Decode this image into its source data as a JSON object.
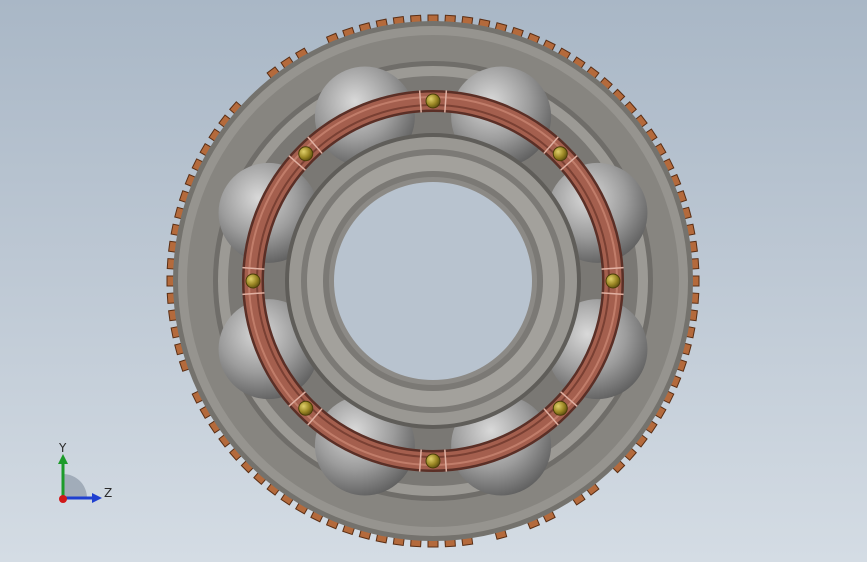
{
  "viewport": {
    "model": "deep-groove-ball-bearing",
    "ball_count": 8,
    "rivet_count": 8,
    "colors": {
      "outer_ring": "#8f8d88",
      "inner_ring": "#8c8a86",
      "balls": "#9a9a9a",
      "cage": "#a45f4e",
      "rivets": "#8a7a20",
      "teeth": "#b46a3c"
    }
  },
  "triad": {
    "y_label": "Y",
    "z_label": "Z",
    "colors": {
      "y": "#1c9b2a",
      "z": "#1f3fd0",
      "x": "#d01818"
    }
  }
}
